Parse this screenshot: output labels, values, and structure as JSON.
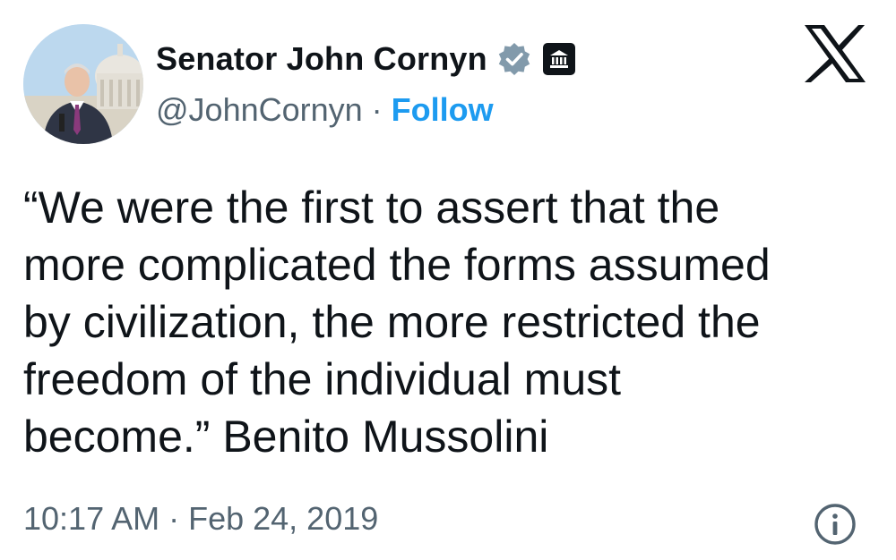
{
  "author": {
    "display_name": "Senator John Cornyn",
    "handle": "@JohnCornyn",
    "separator": "·",
    "follow_label": "Follow",
    "avatar_icon": "profile-photo-capitol",
    "verified_icon": "verified-badge-icon",
    "affiliation_icon": "government-building-icon"
  },
  "tweet": {
    "lines": [
      "“We were the first to assert that the",
      "more complicated the forms assumed",
      "by civilization, the more restricted the",
      "freedom of the individual must",
      "become.” Benito Mussolini"
    ],
    "timestamp": "10:17 AM · Feb 24, 2019"
  },
  "colors": {
    "text": "#0f1419",
    "secondary": "#536471",
    "follow": "#1d9bf0",
    "verified_badge": "#829aab"
  }
}
